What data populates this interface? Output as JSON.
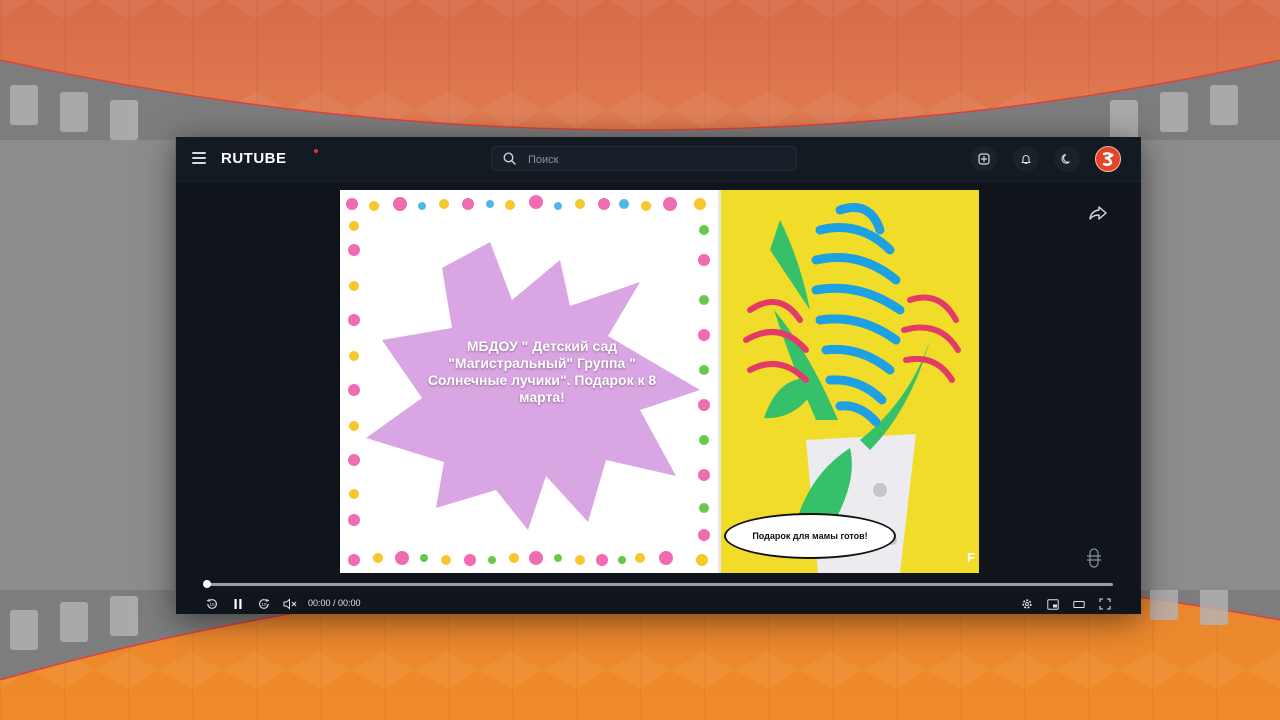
{
  "header": {
    "logo_text": "RUTUBE",
    "search_placeholder": "Поиск"
  },
  "video": {
    "title_card": "МБДОУ \" Детский сад \"Магистральный\" Группа \" Солнечные лучики\". Подарок к 8 марта!",
    "speech_bubble": "Подарок для мамы готов!",
    "corner_text": "F"
  },
  "player": {
    "time": "00:00 / 00:00",
    "progress": 0
  },
  "colors": {
    "brand_red": "#ee2b3c",
    "star_lilac": "#d9a5e2",
    "background_orange": "#f08a28",
    "window_dark": "#10151c"
  }
}
